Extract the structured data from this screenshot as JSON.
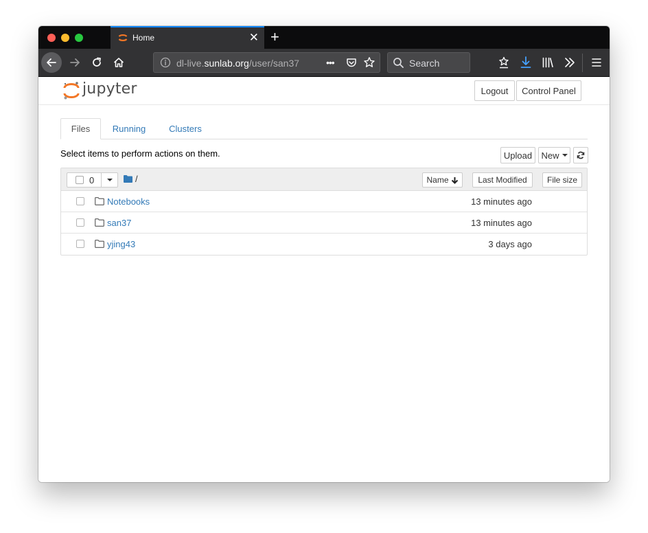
{
  "browser": {
    "tab": {
      "title": "Home",
      "close_symbol": "✕"
    },
    "new_tab_symbol": "+",
    "url": {
      "prefix": "dl-live.",
      "host": "sunlab.org",
      "path": "/user/san37"
    },
    "page_actions_label": "•••",
    "search": {
      "placeholder": "Search"
    }
  },
  "jupyter": {
    "wordmark": "jupyter",
    "header_buttons": {
      "logout": "Logout",
      "control_panel": "Control Panel"
    },
    "tabs": [
      {
        "label": "Files"
      },
      {
        "label": "Running"
      },
      {
        "label": "Clusters"
      }
    ],
    "select_hint": "Select items to perform actions on them.",
    "actions": {
      "upload": "Upload",
      "new": "New"
    },
    "list_header": {
      "selected_count": "0",
      "breadcrumb": "/",
      "sort_name": "Name",
      "sort_name_arrow": "🡓",
      "sort_modified": "Last Modified",
      "sort_size": "File size"
    },
    "files": [
      {
        "name": "Notebooks",
        "modified": "13 minutes ago"
      },
      {
        "name": "san37",
        "modified": "13 minutes ago"
      },
      {
        "name": "yjing43",
        "modified": "3 days ago"
      }
    ]
  },
  "colors": {
    "link_blue": "#337ab7",
    "jupyter_orange": "#f37726",
    "firefox_blue": "#0a84ff",
    "toolbar_dark": "#323234"
  }
}
